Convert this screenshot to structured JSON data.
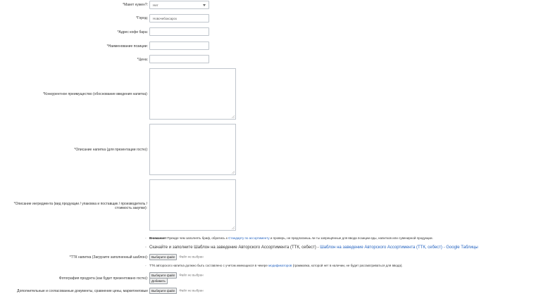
{
  "fields": {
    "need_layout": {
      "label": "*Макет нужен?:",
      "value": "Нет"
    },
    "city": {
      "label": "*Город:",
      "value": "Новочебоксарск"
    },
    "address": {
      "label": "*Адрес кофе бара:",
      "value": ""
    },
    "item_name": {
      "label": "*Наименование позиции:",
      "value": ""
    },
    "price": {
      "label": "*Цена:",
      "value": ""
    },
    "advantage": {
      "label": "*Конкурентное преимущество (обоснование введения напитка):"
    },
    "description": {
      "label": "*Описание напитка (для презентации гостю):"
    },
    "ingredients": {
      "label": "*Описание ингредиента (вид продукции / упаковка и поставщик / производитель / стоимость закупки):"
    },
    "ttk": {
      "label": "*ТТК напитка (Загрузите заполненный шаблон):"
    },
    "photo": {
      "label": "Фотография продукта (как будет презентовано гостю):"
    },
    "extra": {
      "label": "Дополнительные и согласованные документы, сравнение цены, маркетинговые"
    }
  },
  "notes": {
    "warning_bold": "Внимание!",
    "warning_pre": " Прежде чем заполнять бриф, обратись к ",
    "warning_link": "Стандарту по ассортименту",
    "warning_post": " и проверь, не предлагаешь ли ты запрещённые для ввода позиции еды, напитков или сувенирной продукции.",
    "template_pre": "Скачайте и заполните Шаблон на заведение Авторского Ассортимента (ТТК, себест) - ",
    "template_link": "Шаблон на заведение Авторского Ассортимента (ТТК, себест) - Google Таблицы",
    "ttk_pre": "ТТК авторского напитка должно быть составлено с учетом имеющихся в чекере ",
    "ttk_link": "модификаторов",
    "ttk_post": " (граммовка, которой нет в наличии, не будет рассматриваться для ввода)."
  },
  "file_input": {
    "button": "Выберите файл",
    "status": "Файл не выбран",
    "add_button": "Добавить"
  }
}
